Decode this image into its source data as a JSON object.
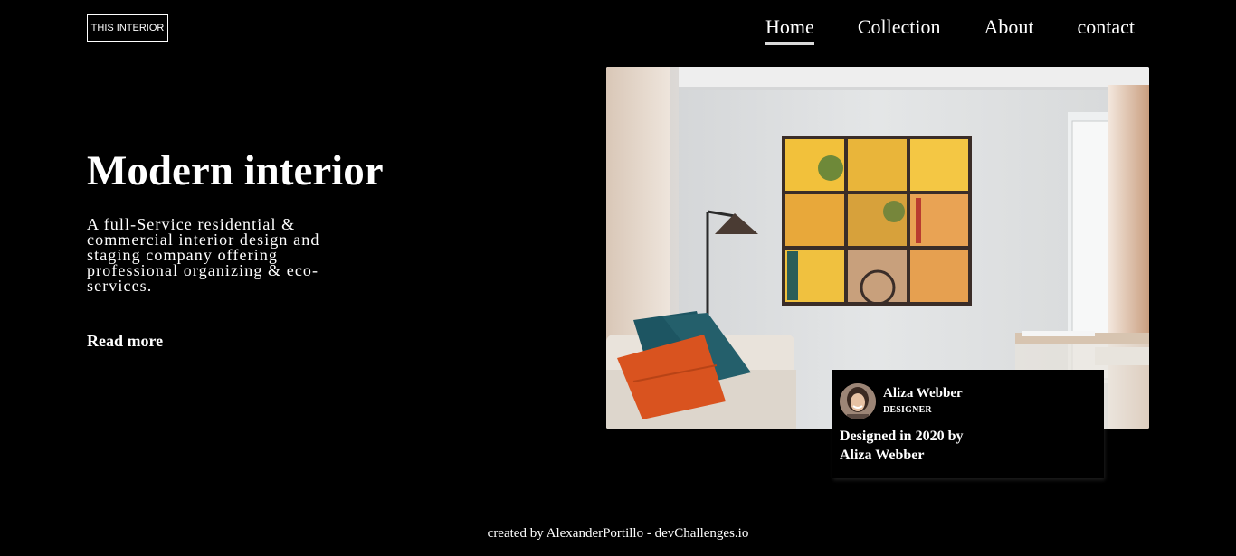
{
  "header": {
    "logo_text": "THIS INTERIOR",
    "nav": [
      {
        "label": "Home",
        "active": true
      },
      {
        "label": "Collection",
        "active": false
      },
      {
        "label": "About",
        "active": false
      },
      {
        "label": "contact",
        "active": false
      }
    ]
  },
  "hero": {
    "title": "Modern interior",
    "description": "A full-Service residential & commercial interior design and staging company offering professional organizing & eco-services.",
    "read_more": "Read more"
  },
  "photo": {
    "subject": "living-room-interior-image"
  },
  "designer_card": {
    "name": "Aliza Webber",
    "role": "DESIGNER",
    "text": "Designed in 2020 by Aliza Webber"
  },
  "footer": {
    "credit": "created by AlexanderPortillo - devChallenges.io"
  },
  "colors": {
    "background": "#000000",
    "text": "#ffffff",
    "nav_underline": "#d9d9d9"
  }
}
